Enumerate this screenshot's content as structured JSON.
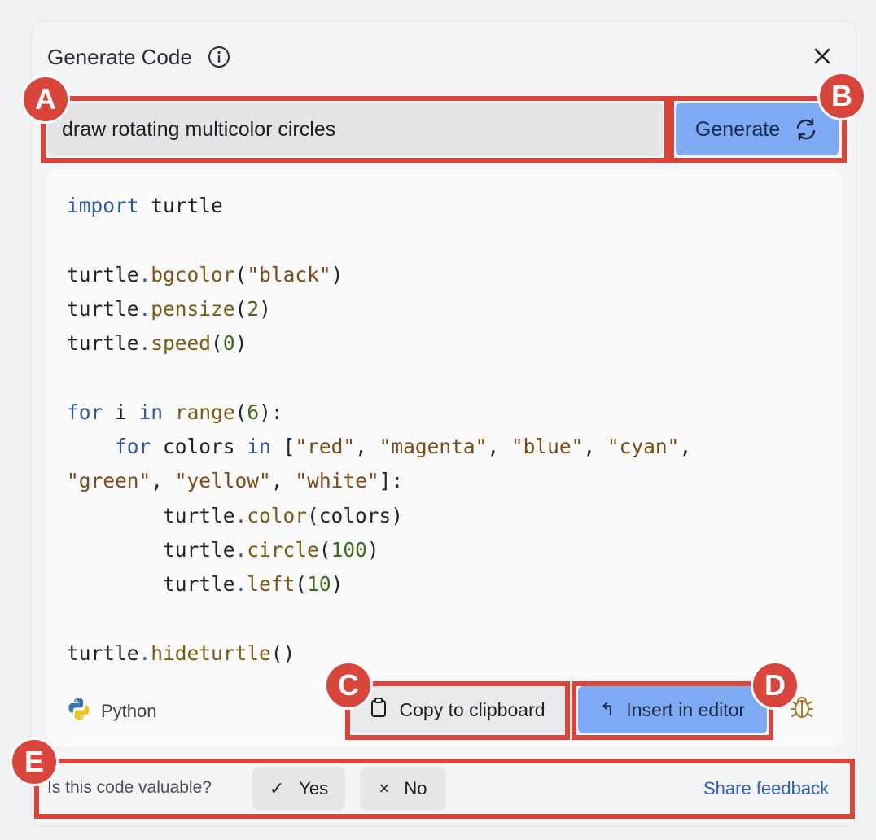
{
  "dialog": {
    "title": "Generate Code",
    "close_glyph": "×"
  },
  "prompt": {
    "value": "draw rotating multicolor circles",
    "generate_label": "Generate"
  },
  "code": {
    "language": "Python",
    "lines": [
      [
        {
          "t": "import",
          "c": "kw"
        },
        {
          "t": " turtle"
        }
      ],
      [],
      [
        {
          "t": "turtle"
        },
        {
          "t": ".",
          "c": "dot"
        },
        {
          "t": "bgcolor",
          "c": "fn"
        },
        {
          "t": "("
        },
        {
          "t": "\"black\"",
          "c": "str"
        },
        {
          "t": ")"
        }
      ],
      [
        {
          "t": "turtle"
        },
        {
          "t": ".",
          "c": "dot"
        },
        {
          "t": "pensize",
          "c": "fn"
        },
        {
          "t": "("
        },
        {
          "t": "2",
          "c": "num"
        },
        {
          "t": ")"
        }
      ],
      [
        {
          "t": "turtle"
        },
        {
          "t": ".",
          "c": "dot"
        },
        {
          "t": "speed",
          "c": "fn"
        },
        {
          "t": "("
        },
        {
          "t": "0",
          "c": "num"
        },
        {
          "t": ")"
        }
      ],
      [],
      [
        {
          "t": "for",
          "c": "kw"
        },
        {
          "t": " i "
        },
        {
          "t": "in",
          "c": "kw"
        },
        {
          "t": " "
        },
        {
          "t": "range",
          "c": "fn"
        },
        {
          "t": "("
        },
        {
          "t": "6",
          "c": "num"
        },
        {
          "t": "):"
        }
      ],
      [
        {
          "t": "    "
        },
        {
          "t": "for",
          "c": "kw"
        },
        {
          "t": " colors "
        },
        {
          "t": "in",
          "c": "kw"
        },
        {
          "t": " ["
        },
        {
          "t": "\"red\"",
          "c": "str"
        },
        {
          "t": ", "
        },
        {
          "t": "\"magenta\"",
          "c": "str"
        },
        {
          "t": ", "
        },
        {
          "t": "\"blue\"",
          "c": "str"
        },
        {
          "t": ", "
        },
        {
          "t": "\"cyan\"",
          "c": "str"
        },
        {
          "t": ","
        }
      ],
      [
        {
          "t": "\"green\"",
          "c": "str"
        },
        {
          "t": ", "
        },
        {
          "t": "\"yellow\"",
          "c": "str"
        },
        {
          "t": ", "
        },
        {
          "t": "\"white\"",
          "c": "str"
        },
        {
          "t": "]:"
        }
      ],
      [
        {
          "t": "        turtle"
        },
        {
          "t": ".",
          "c": "dot"
        },
        {
          "t": "color",
          "c": "fn"
        },
        {
          "t": "(colors)"
        }
      ],
      [
        {
          "t": "        turtle"
        },
        {
          "t": ".",
          "c": "dot"
        },
        {
          "t": "circle",
          "c": "fn"
        },
        {
          "t": "("
        },
        {
          "t": "100",
          "c": "num"
        },
        {
          "t": ")"
        }
      ],
      [
        {
          "t": "        turtle"
        },
        {
          "t": ".",
          "c": "dot"
        },
        {
          "t": "left",
          "c": "fn"
        },
        {
          "t": "("
        },
        {
          "t": "10",
          "c": "num"
        },
        {
          "t": ")"
        }
      ],
      [],
      [
        {
          "t": "turtle"
        },
        {
          "t": ".",
          "c": "dot"
        },
        {
          "t": "hideturtle",
          "c": "fn"
        },
        {
          "t": "()"
        }
      ]
    ]
  },
  "actions": {
    "copy_label": "Copy to clipboard",
    "insert_label": "Insert in editor",
    "insert_glyph": "↰"
  },
  "feedback": {
    "question": "Is this code valuable?",
    "yes_glyph": "✓",
    "yes_label": "Yes",
    "no_glyph": "×",
    "no_label": "No",
    "share_label": "Share feedback"
  },
  "annotations": {
    "a": "A",
    "b": "B",
    "c": "C",
    "d": "D",
    "e": "E"
  },
  "colors": {
    "accent_button": "#7ea9f3",
    "annotation_red": "#d9443b",
    "keyword": "#2f57a8",
    "string": "#7b4a17",
    "number": "#3d6b1e"
  }
}
